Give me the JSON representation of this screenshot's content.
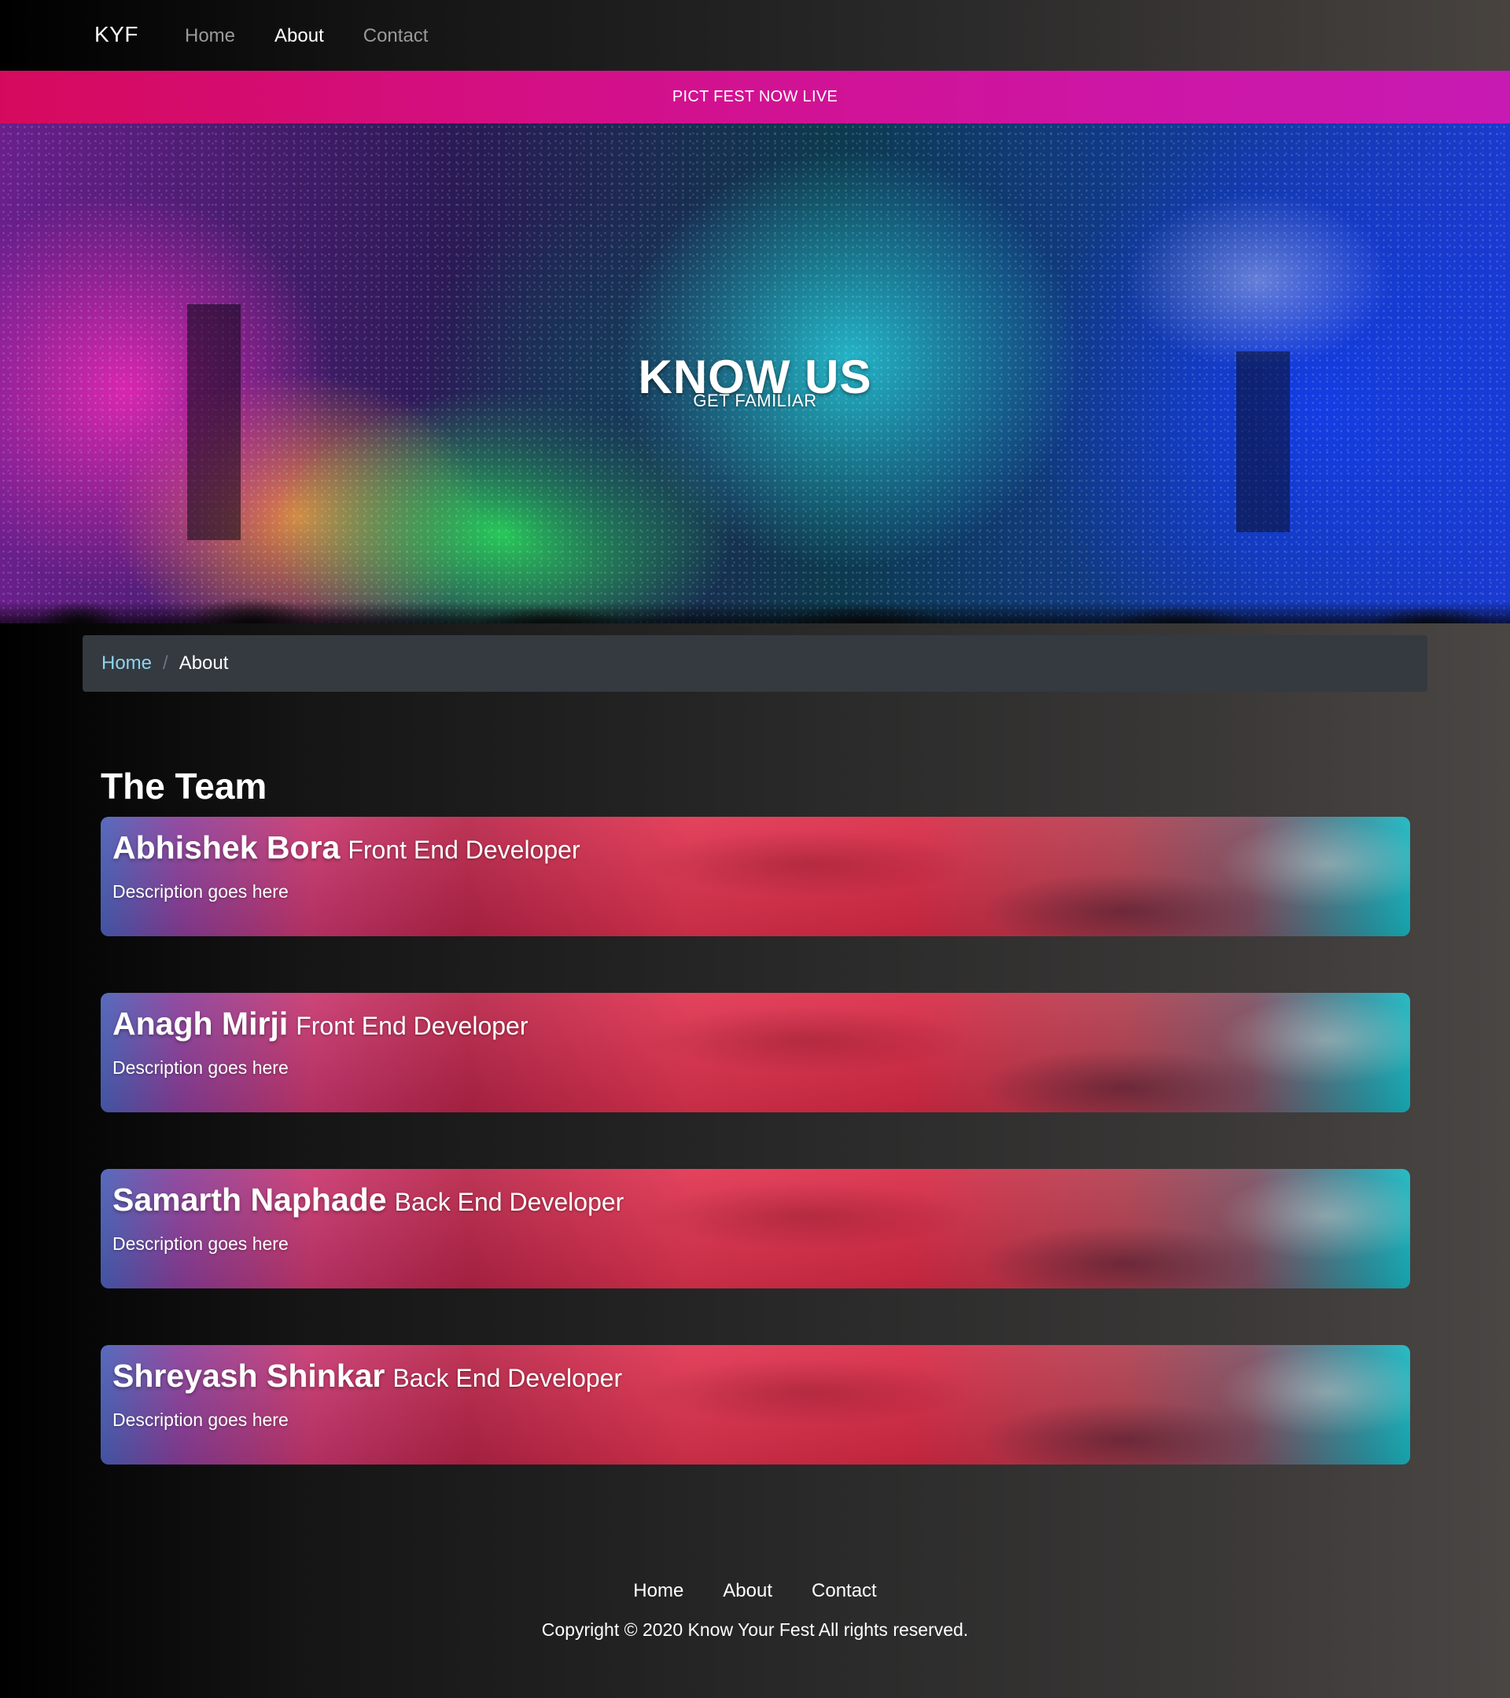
{
  "navbar": {
    "brand": "KYF",
    "links": [
      {
        "label": "Home",
        "active": false
      },
      {
        "label": "About",
        "active": true
      },
      {
        "label": "Contact",
        "active": false
      }
    ]
  },
  "banner": {
    "text": "PICT FEST NOW LIVE"
  },
  "hero": {
    "title": "KNOW US",
    "subtitle": "GET FAMILIAR"
  },
  "breadcrumb": {
    "home": "Home",
    "separator": "/",
    "current": "About"
  },
  "team": {
    "title": "The Team",
    "members": [
      {
        "name": "Abhishek Bora",
        "role": "Front End Developer",
        "description": "Description goes here"
      },
      {
        "name": "Anagh Mirji",
        "role": "Front End Developer",
        "description": "Description goes here"
      },
      {
        "name": "Samarth Naphade",
        "role": "Back End Developer",
        "description": "Description goes here"
      },
      {
        "name": "Shreyash Shinkar",
        "role": "Back End Developer",
        "description": "Description goes here"
      }
    ]
  },
  "footer": {
    "links": [
      "Home",
      "About",
      "Contact"
    ],
    "copyright": "Copyright © 2020 Know Your Fest All rights reserved."
  },
  "colors": {
    "banner_start": "#d60a5d",
    "banner_end": "#c71ab3",
    "breadcrumb_bg": "#343a40",
    "breadcrumb_link": "#8fd3ee"
  }
}
